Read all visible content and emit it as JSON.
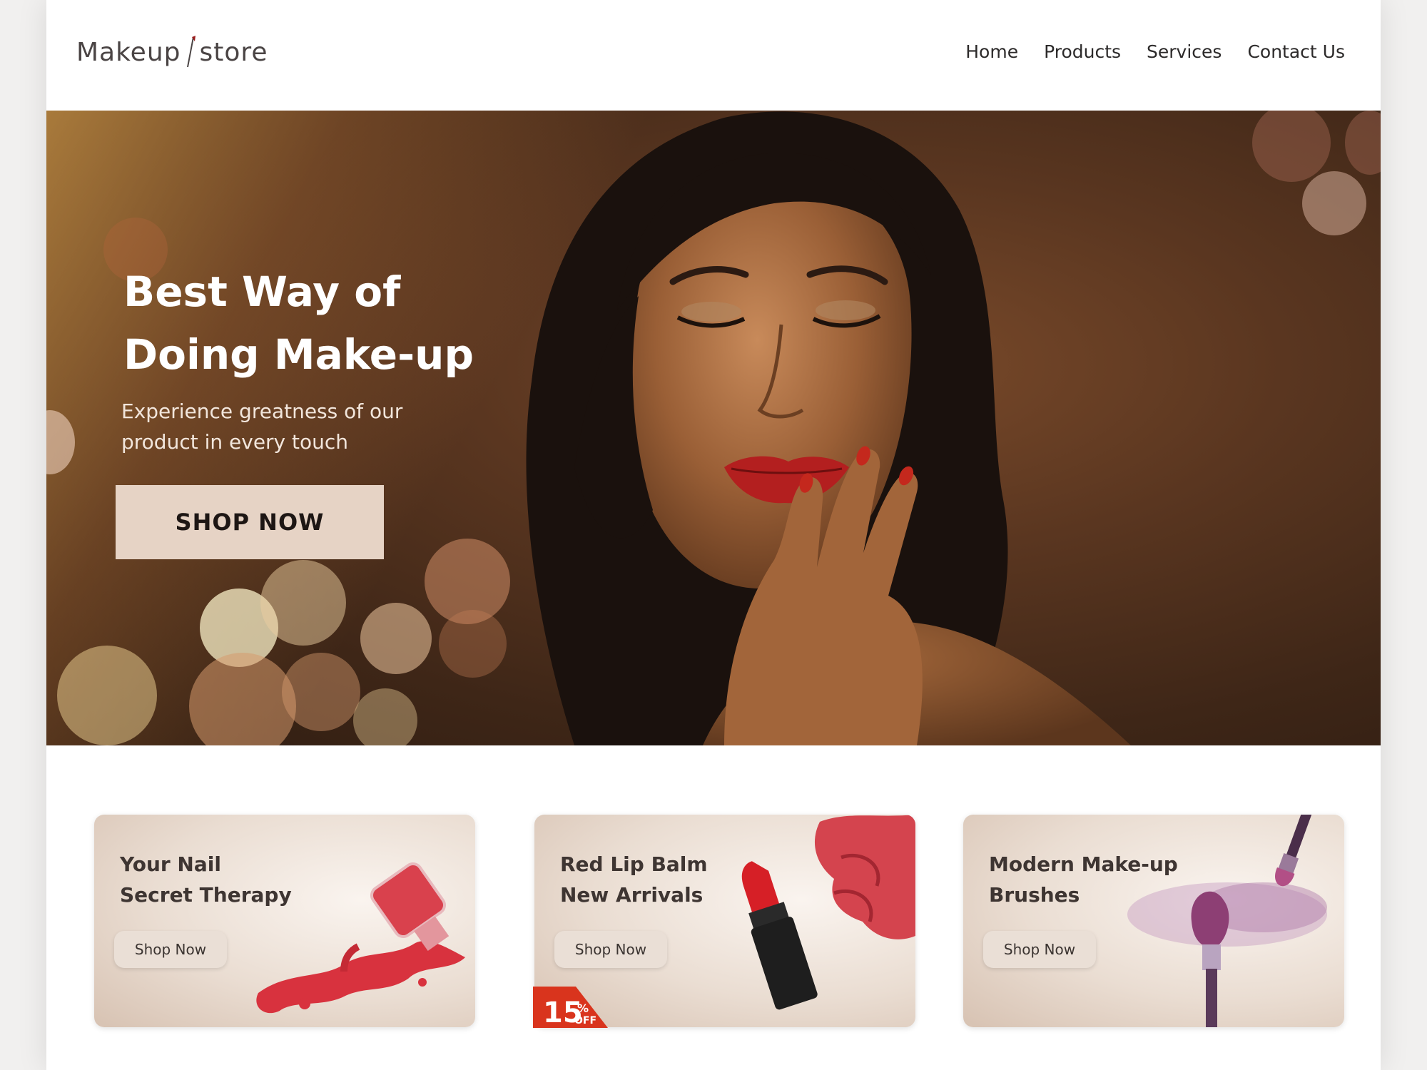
{
  "header": {
    "logo_left": "Makeup",
    "logo_right": "store",
    "nav": [
      "Home",
      "Products",
      "Services",
      "Contact Us"
    ]
  },
  "hero": {
    "title_line1": "Best Way of",
    "title_line2": "Doing Make-up",
    "subtitle_line1": "Experience greatness of our",
    "subtitle_line2": "product in every touch",
    "cta": "SHOP NOW"
  },
  "cards": [
    {
      "title_line1": "Your Nail",
      "title_line2": "Secret Therapy",
      "button": "Shop Now",
      "image": "nail-polish-icon"
    },
    {
      "title_line1": "Red Lip Balm",
      "title_line2": "New Arrivals",
      "button": "Shop Now",
      "image": "lipstick-icon",
      "badge_number": "15",
      "badge_pct": "%",
      "badge_off": "OFF"
    },
    {
      "title_line1": "Modern Make-up",
      "title_line2": "Brushes",
      "button": "Shop Now",
      "image": "makeup-brush-icon"
    }
  ],
  "colors": {
    "accent": "#e6d3c5",
    "text_dark": "#2c2a2a",
    "badge_red": "#d9341d"
  }
}
